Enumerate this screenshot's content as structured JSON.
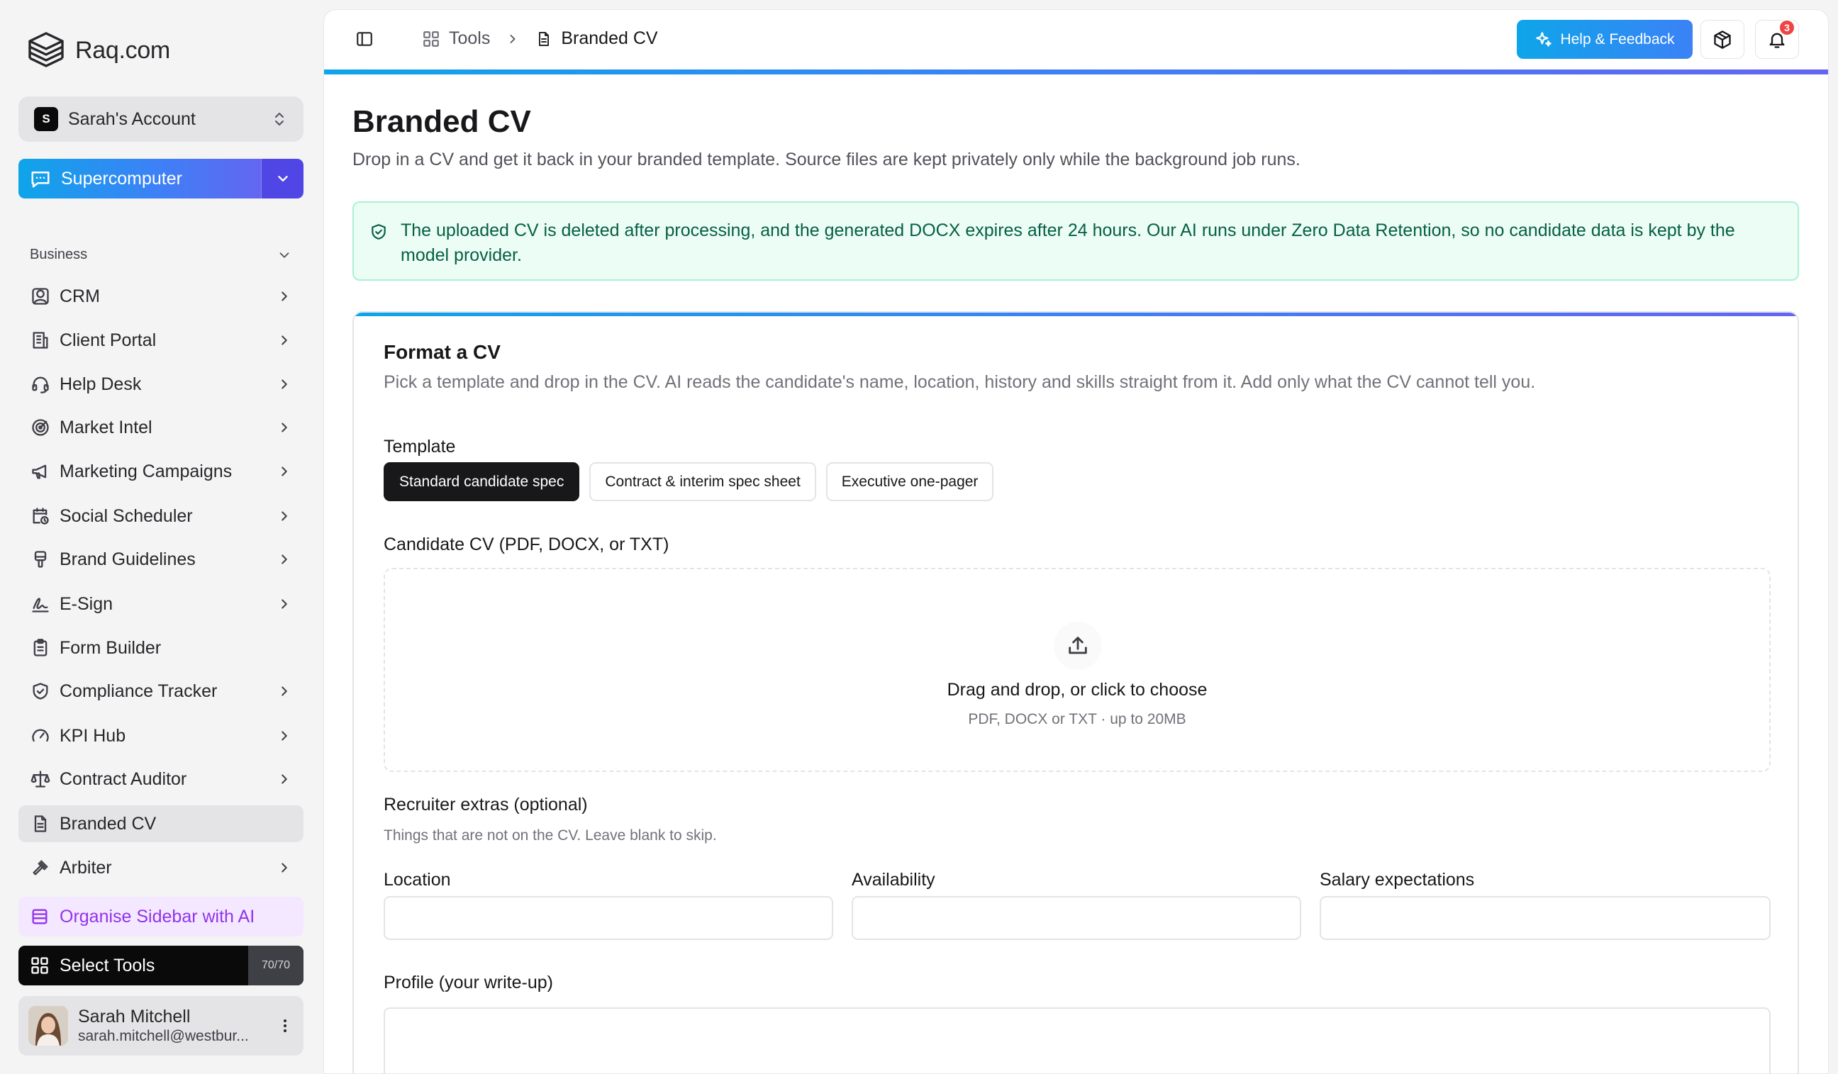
{
  "brand": {
    "name": "Raq.com"
  },
  "account": {
    "initial": "S",
    "name": "Sarah's Account"
  },
  "supercomputer": {
    "label": "Supercomputer"
  },
  "sidebar": {
    "group_label": "Business",
    "items": [
      {
        "label": "CRM",
        "icon": "user-circle-icon",
        "chevron": true
      },
      {
        "label": "Client Portal",
        "icon": "building-icon",
        "chevron": true
      },
      {
        "label": "Help Desk",
        "icon": "headset-icon",
        "chevron": true
      },
      {
        "label": "Market Intel",
        "icon": "radar-icon",
        "chevron": true
      },
      {
        "label": "Marketing Campaigns",
        "icon": "megaphone-icon",
        "chevron": true
      },
      {
        "label": "Social Scheduler",
        "icon": "calendar-clock-icon",
        "chevron": true
      },
      {
        "label": "Brand Guidelines",
        "icon": "paint-bucket-icon",
        "chevron": true
      },
      {
        "label": "E-Sign",
        "icon": "signature-icon",
        "chevron": true
      },
      {
        "label": "Form Builder",
        "icon": "clipboard-icon",
        "chevron": false
      },
      {
        "label": "Compliance Tracker",
        "icon": "shield-check-icon",
        "chevron": true
      },
      {
        "label": "KPI Hub",
        "icon": "gauge-icon",
        "chevron": true
      },
      {
        "label": "Contract Auditor",
        "icon": "scale-icon",
        "chevron": true
      },
      {
        "label": "Branded CV",
        "icon": "file-text-icon",
        "chevron": false,
        "active": true
      },
      {
        "label": "Arbiter",
        "icon": "gavel-icon",
        "chevron": true
      }
    ],
    "organise_label": "Organise Sidebar with AI",
    "select_tools_label": "Select Tools",
    "select_tools_count": "70/70"
  },
  "user": {
    "name": "Sarah Mitchell",
    "email": "sarah.mitchell@westbur..."
  },
  "topbar": {
    "breadcrumb_root": "Tools",
    "breadcrumb_current": "Branded CV",
    "help_label": "Help & Feedback",
    "notification_count": "3"
  },
  "page": {
    "title": "Branded CV",
    "subtitle": "Drop in a CV and get it back in your branded template. Source files are kept privately only while the background job runs.",
    "notice": "The uploaded CV is deleted after processing, and the generated DOCX expires after 24 hours. Our AI runs under Zero Data Retention, so no candidate data is kept by the model provider."
  },
  "form": {
    "title": "Format a CV",
    "subtitle": "Pick a template and drop in the CV. AI reads the candidate's name, location, history and skills straight from it. Add only what the CV cannot tell you.",
    "template_label": "Template",
    "templates": [
      {
        "label": "Standard candidate spec",
        "selected": true
      },
      {
        "label": "Contract & interim spec sheet",
        "selected": false
      },
      {
        "label": "Executive one-pager",
        "selected": false
      }
    ],
    "cv_label": "Candidate CV (PDF, DOCX, or TXT)",
    "dropzone_title": "Drag and drop, or click to choose",
    "dropzone_hint": "PDF, DOCX or TXT · up to 20MB",
    "extras_label": "Recruiter extras (optional)",
    "extras_sub": "Things that are not on the CV. Leave blank to skip.",
    "location_label": "Location",
    "location_value": "",
    "availability_label": "Availability",
    "availability_value": "",
    "salary_label": "Salary expectations",
    "salary_value": "",
    "profile_label": "Profile (your write-up)"
  },
  "colors": {
    "accent_blue": "#3b82f6",
    "accent_sky": "#0ea5e9",
    "accent_indigo": "#6366f1",
    "notice_bg": "#ecfdf5",
    "notice_text": "#065f46",
    "organise_purple": "#9333ea",
    "badge_red": "#ef4444"
  }
}
